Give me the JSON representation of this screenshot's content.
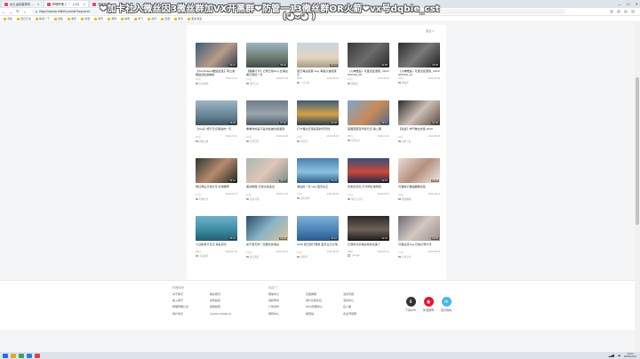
{
  "browser": {
    "tabs": [
      {
        "label": "女士运动装饰衣 ...",
        "active": false
      },
      {
        "label": "哔哩哔哩 (゜-゜)つロ",
        "active": true
      },
      {
        "label": "搜索结果",
        "active": false
      }
    ],
    "url": "https://search.bilibili.com/all?keyword=",
    "bookmarks": [
      "书签",
      "宝石汇总",
      "我来一下",
      "合集",
      "电影",
      "动漫",
      "音乐",
      "游戏",
      "搞笑",
      "学习",
      "资讯",
      "百度",
      "知乎",
      "更多书签"
    ]
  },
  "panel": {
    "sort_label": "综合 ▾"
  },
  "cards": [
    {
      "title": "【TomHolland舞蹈合集】荷兰弟舞蹈合集超精彩",
      "views": "4.5万",
      "date": "2019-06-11",
      "author": "抖音舞蹈",
      "duration": "03:21",
      "bg": "linear-gradient(135deg,#3b5d7a,#b99b88 55%,#2d3b4e)"
    },
    {
      "title": "【假期打卡】记录日常vlog 去海边看日落的一天",
      "views": "2.1万",
      "date": "2019-07-03",
      "author": "旅行日记",
      "duration": "05:42",
      "bg": "linear-gradient(180deg,#9fb4c4,#6d7e73 60%,#3f4a45)"
    },
    {
      "title": "夏日海边度假 vlog 海浪沙滩和落日",
      "views": "8832",
      "date": "2019-08-02",
      "author": "一只小鱼",
      "duration": "04:10",
      "bg": "linear-gradient(180deg,#c6d6e2,#e3d5c0 60%,#a89b86)"
    },
    {
      "title": "（火神舞蹈）可爱合集混剪_4SUX SHOKS_05",
      "views": "1.2万",
      "date": "2019-05-20",
      "author": "舞蹈区",
      "duration": "02:58",
      "bg": "linear-gradient(135deg,#3a3a3a,#6b6b6b 50%,#2a2a2a)"
    },
    {
      "title": "（火神舞蹈）可爱合集混剪_4SUX SHOKS_12",
      "views": "9741",
      "date": "2019-05-28",
      "author": "舞蹈区",
      "duration": "03:05",
      "bg": "linear-gradient(135deg,#2e2e2e,#7a7a7a 50%,#1f1f1f)"
    },
    {
      "title": "【Vlog】旅行日记海边的一天",
      "views": "6.3万",
      "date": "2019-07-15",
      "author": "旅拍小组",
      "duration": "06:33",
      "bg": "linear-gradient(180deg,#9eb7c8,#5f7a8b 70%,#3e5361)"
    },
    {
      "title": "看看你的是不是也会被这些骗到",
      "views": "3.4万",
      "date": "2019-06-09",
      "author": "生活百科",
      "duration": "07:02",
      "bg": "linear-gradient(180deg,#6f7d8a,#9aa6ad 55%,#4b5661)"
    },
    {
      "title": "打卡海边日落最美的风景线",
      "views": "1.9万",
      "date": "2019-08-18",
      "author": "风景君",
      "duration": "03:48",
      "bg": "linear-gradient(180deg,#3e5c7a,#d2a24b 55%,#2c3e4f)"
    },
    {
      "title": "美国西部自驾游日记 第二期",
      "views": "5671",
      "date": "2019-07-22",
      "author": "自驾达人",
      "duration": "09:12",
      "bg": "linear-gradient(135deg,#7fa5c9,#c98a5a 55%,#4d6a8a)"
    },
    {
      "title": "【肖战】帅气舞台合集 2019",
      "views": "12万",
      "date": "2019-08-05",
      "author": "追星少女",
      "duration": "04:26",
      "bg": "linear-gradient(135deg,#2e2a2a,#cdbfb5 50%,#5a4c45)"
    },
    {
      "title": "网红博主日常分享 好物推荐",
      "views": "2.7万",
      "date": "2019-06-27",
      "author": "好物分享",
      "duration": "05:01",
      "bg": "linear-gradient(135deg,#2b3a2f,#b98a6e 50%,#1e2a22)"
    },
    {
      "title": "美妆教程 日常淡妆画法",
      "views": "4.4万",
      "date": "2019-07-30",
      "author": "美妆小课",
      "duration": "08:14",
      "bg": "linear-gradient(135deg,#a8b6b0,#e0c6b8 50%,#7e8c86)"
    },
    {
      "title": "海边的一天 vlog 蓝天白云",
      "views": "7712",
      "date": "2019-08-09",
      "author": "蓝色海洋",
      "duration": "03:33",
      "bg": "linear-gradient(180deg,#4a7fb0,#8cc2e0 55%,#2e5c86)"
    },
    {
      "title": "周末出去玩 打卡网红咖啡店",
      "views": "1.1万",
      "date": "2019-06-15",
      "author": "探店小分队",
      "duration": "04:57",
      "bg": "linear-gradient(180deg,#3a4f7a,#c8483c 55%,#1f2a44)"
    },
    {
      "title": "可爱妹子舞蹈翻跳合集",
      "views": "3.2万",
      "date": "2019-08-12",
      "author": "舞蹈翻跳",
      "duration": "02:44",
      "bg": "linear-gradient(135deg,#e6dcd8,#b68f7e 50%,#f1e9e5)"
    },
    {
      "title": "小清新旅行日记 海岛风光",
      "views": "9321",
      "date": "2019-07-08",
      "author": "海岛旅行",
      "duration": "05:19",
      "bg": "linear-gradient(180deg,#6fb1c9,#3d8da3 55%,#245e70)"
    },
    {
      "title": "关于夏天你一定要去的海边",
      "views": "2.3万",
      "date": "2019-08-21",
      "author": "夏日限定",
      "duration": "04:02",
      "bg": "linear-gradient(135deg,#2b4c6a,#8ab4c7 50%,#d8c49a)"
    },
    {
      "title": "2019 夏日旅行混剪 蓝天白云大海",
      "views": "1.6万",
      "date": "2019-08-25",
      "author": "混剪师",
      "duration": "03:16",
      "bg": "linear-gradient(180deg,#7fb0d6,#4c84b8 55%,#2b5a8a)"
    },
    {
      "title": "日落时分的海边真的太美了",
      "views": "4890",
      "date": "2019-07-19",
      "author": "_jiangge",
      "duration": "02:31",
      "bg": "linear-gradient(180deg,#2a2a2a,#6e6258 55%,#1a1a1a)"
    },
    {
      "title": "可爱女孩vlog 日常记录分享",
      "views": "1.4万",
      "date": "2019-08-28",
      "author": "日常记录",
      "duration": "06:05",
      "bg": "linear-gradient(135deg,#6c6c74,#d3c7c3 50%,#9a8e8a)"
    }
  ],
  "pager": [
    "上一页",
    "1",
    "2",
    "3",
    "4",
    "5",
    "6",
    "7",
    "...",
    "10",
    "下一页"
  ],
  "pager_current": "2",
  "footer": {
    "col1": {
      "head": "哔哩哔哩",
      "links": [
        "关于我们",
        "联系我们",
        "加入我们",
        "友情链接",
        "哔哩哔哩认证",
        "投稿指南",
        "用户协议",
        "Investor Relations"
      ]
    },
    "col2": {
      "head": "传送门",
      "links": [
        "帮助中心",
        "高级弹幕",
        "活动专题",
        "侵权申诉",
        "用户反馈论坛",
        "活动中心",
        "广告合作",
        "MCN管理中心",
        "名人堂",
        "规则中心",
        "壁纸站",
        "企业号官网"
      ]
    },
    "buttons": [
      {
        "label": "下载APP",
        "color": "#333"
      },
      {
        "label": "新浪微博",
        "color": "#e6162d"
      },
      {
        "label": "官方微信",
        "color": "#48b8e8"
      }
    ]
  },
  "taskbar": {
    "time": "10:04",
    "date": "2019/12/12"
  },
  "watermark": {
    "line1": "❤加卡社入微丝因3微丝群加VX开黑群❤防管一13微丝群OR火箭❤vx号dqbie_cst",
    "line2": "(◕ᴗ◕ )"
  }
}
